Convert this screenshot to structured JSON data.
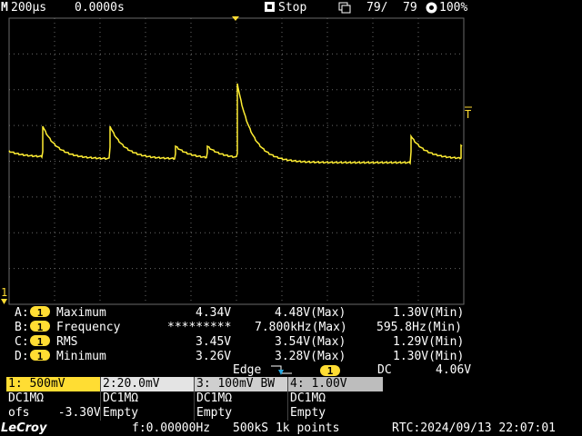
{
  "colors": {
    "ch1": "#ffdd33",
    "grid": "#6a6a6a",
    "trace": "#ffee33",
    "ch2_header": "#e4e4e4",
    "ch3_header": "#cfcfcf",
    "ch4_header": "#bdbdbd",
    "dim": "#cfcfcf"
  },
  "top": {
    "timebase": "200µs",
    "delay": "0.0000s",
    "run_state": "Stop",
    "frame": "79/",
    "frames_total": "79",
    "battery": "100%"
  },
  "markers": {
    "ch1_ground": "1",
    "trigger_level": "T"
  },
  "measurements": [
    {
      "slot": "A:",
      "channel": "1",
      "name": "Maximum",
      "value": "4.34V",
      "max": "4.48V(Max)",
      "min": "1.30V(Min)"
    },
    {
      "slot": "B:",
      "channel": "1",
      "name": "Frequency",
      "value": "*********",
      "max": "7.800kHz(Max)",
      "min": "595.8Hz(Min)"
    },
    {
      "slot": "C:",
      "channel": "1",
      "name": "RMS",
      "value": "3.45V",
      "max": "3.54V(Max)",
      "min": "1.29V(Min)"
    },
    {
      "slot": "D:",
      "channel": "1",
      "name": "Minimum",
      "value": "3.26V",
      "max": "3.28V(Max)",
      "min": "1.30V(Min)"
    }
  ],
  "trigger": {
    "type": "Edge",
    "source": "1",
    "coupling": "DC",
    "level": "4.06V"
  },
  "channels": [
    {
      "header": "1: 500mV",
      "coupling": "DC1MΩ",
      "extra": "ofs    -3.30V"
    },
    {
      "header": "2:20.0mV",
      "coupling": "DC1MΩ",
      "extra": "Empty"
    },
    {
      "header": "3: 100mV  BW",
      "coupling": "DC1MΩ",
      "extra": "Empty"
    },
    {
      "header": "4: 1.00V",
      "coupling": "DC1MΩ",
      "extra": "Empty"
    }
  ],
  "bottom": {
    "brand": "LeCroy",
    "counter": "f:0.00000Hz",
    "acquisition": "500kS 1k points",
    "rtc": "RTC:2024/09/13 22:07:01"
  }
}
